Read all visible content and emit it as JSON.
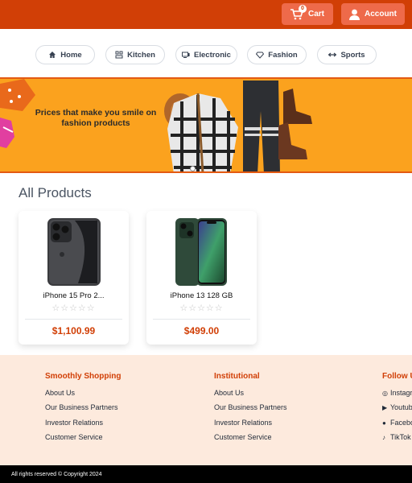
{
  "header": {
    "cart_label": "Cart",
    "cart_count": "0",
    "account_label": "Account"
  },
  "categories": [
    {
      "label": "Home",
      "icon": "home-icon"
    },
    {
      "label": "Kitchen",
      "icon": "kitchen-icon"
    },
    {
      "label": "Electronic",
      "icon": "electronic-icon"
    },
    {
      "label": "Fashion",
      "icon": "fashion-icon"
    },
    {
      "label": "Sports",
      "icon": "sports-icon"
    }
  ],
  "banner": {
    "text": "Prices that make you smile on fashion products"
  },
  "products": {
    "title": "All Products",
    "items": [
      {
        "name": "iPhone 15 Pro 2...",
        "price": "$1,100.99",
        "rating": 0
      },
      {
        "name": "iPhone 13 128 GB",
        "price": "$499.00",
        "rating": 0
      }
    ]
  },
  "footer": {
    "columns": [
      {
        "title": "Smoothly Shopping",
        "links": [
          "About Us",
          "Our Business Partners",
          "Investor Relations",
          "Customer Service"
        ]
      },
      {
        "title": "Institutional",
        "links": [
          "About Us",
          "Our Business Partners",
          "Investor Relations",
          "Customer Service"
        ]
      },
      {
        "title": "Follow Us",
        "links": [
          "Instagram",
          "Youtube",
          "Facebook",
          "TikTok"
        ],
        "icons": [
          "instagram-icon",
          "youtube-icon",
          "facebook-icon",
          "tiktok-icon"
        ]
      }
    ],
    "copyright": "All rights reserved © Copyright 2024"
  },
  "colors": {
    "brand": "#d13f06",
    "button": "#ee6a4a",
    "banner": "#fba21e",
    "footer_bg": "#fdeadd"
  }
}
